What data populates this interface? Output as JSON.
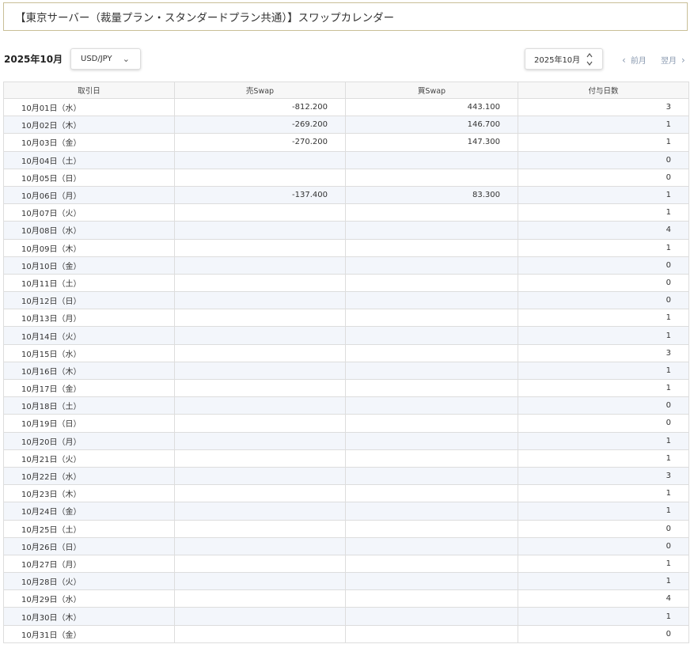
{
  "page": {
    "title": "【東京サーバー（裁量プラン・スタンダードプラン共通）】スワップカレンダー",
    "current_month_label": "2025年10月"
  },
  "controls": {
    "pair_select_value": "USD/JPY",
    "month_select_value": "2025年10月",
    "prev_label": "前月",
    "next_label": "翌月"
  },
  "colors": {
    "title_border": "#c9bf97",
    "row_stripe": "#f3f6fb",
    "nav_link": "#8a9ab0"
  },
  "table": {
    "headers": [
      "取引日",
      "売Swap",
      "買Swap",
      "付与日数"
    ],
    "rows": [
      [
        "10月01日（水）",
        "-812.200",
        "443.100",
        "3"
      ],
      [
        "10月02日（木）",
        "-269.200",
        "146.700",
        "1"
      ],
      [
        "10月03日（金）",
        "-270.200",
        "147.300",
        "1"
      ],
      [
        "10月04日（土）",
        "",
        "",
        "0"
      ],
      [
        "10月05日（日）",
        "",
        "",
        "0"
      ],
      [
        "10月06日（月）",
        "-137.400",
        "83.300",
        "1"
      ],
      [
        "10月07日（火）",
        "",
        "",
        "1"
      ],
      [
        "10月08日（水）",
        "",
        "",
        "4"
      ],
      [
        "10月09日（木）",
        "",
        "",
        "1"
      ],
      [
        "10月10日（金）",
        "",
        "",
        "0"
      ],
      [
        "10月11日（土）",
        "",
        "",
        "0"
      ],
      [
        "10月12日（日）",
        "",
        "",
        "0"
      ],
      [
        "10月13日（月）",
        "",
        "",
        "1"
      ],
      [
        "10月14日（火）",
        "",
        "",
        "1"
      ],
      [
        "10月15日（水）",
        "",
        "",
        "3"
      ],
      [
        "10月16日（木）",
        "",
        "",
        "1"
      ],
      [
        "10月17日（金）",
        "",
        "",
        "1"
      ],
      [
        "10月18日（土）",
        "",
        "",
        "0"
      ],
      [
        "10月19日（日）",
        "",
        "",
        "0"
      ],
      [
        "10月20日（月）",
        "",
        "",
        "1"
      ],
      [
        "10月21日（火）",
        "",
        "",
        "1"
      ],
      [
        "10月22日（水）",
        "",
        "",
        "3"
      ],
      [
        "10月23日（木）",
        "",
        "",
        "1"
      ],
      [
        "10月24日（金）",
        "",
        "",
        "1"
      ],
      [
        "10月25日（土）",
        "",
        "",
        "0"
      ],
      [
        "10月26日（日）",
        "",
        "",
        "0"
      ],
      [
        "10月27日（月）",
        "",
        "",
        "1"
      ],
      [
        "10月28日（火）",
        "",
        "",
        "1"
      ],
      [
        "10月29日（水）",
        "",
        "",
        "4"
      ],
      [
        "10月30日（木）",
        "",
        "",
        "1"
      ],
      [
        "10月31日（金）",
        "",
        "",
        "0"
      ]
    ]
  }
}
